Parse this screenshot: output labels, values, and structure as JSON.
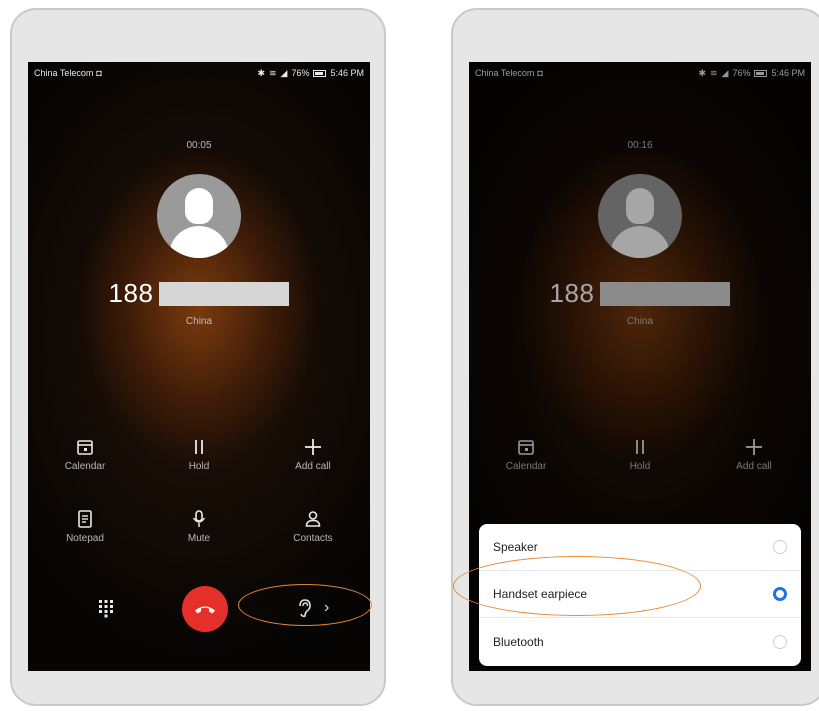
{
  "left": {
    "status": {
      "carrier": "China Telecom",
      "battery": "76%",
      "time": "5:46 PM"
    },
    "timer": "00:05",
    "number": "188",
    "location": "China",
    "actions_row1": [
      {
        "label": "Calendar",
        "icon": "calendar-icon"
      },
      {
        "label": "Hold",
        "icon": "pause-icon"
      },
      {
        "label": "Add call",
        "icon": "plus-icon"
      }
    ],
    "actions_row2": [
      {
        "label": "Notepad",
        "icon": "notepad-icon"
      },
      {
        "label": "Mute",
        "icon": "microphone-icon"
      },
      {
        "label": "Contacts",
        "icon": "person-icon"
      }
    ]
  },
  "right": {
    "status": {
      "carrier": "China Telecom",
      "battery": "76%",
      "time": "5:46 PM"
    },
    "timer": "00:16",
    "number": "188",
    "location": "China",
    "actions_row1": [
      {
        "label": "Calendar",
        "icon": "calendar-icon"
      },
      {
        "label": "Hold",
        "icon": "pause-icon"
      },
      {
        "label": "Add call",
        "icon": "plus-icon"
      }
    ],
    "audio_options": [
      {
        "label": "Speaker",
        "selected": false
      },
      {
        "label": "Handset earpiece",
        "selected": true
      },
      {
        "label": "Bluetooth",
        "selected": false
      }
    ]
  },
  "colors": {
    "end_call": "#e5302a",
    "radio_selected": "#1e72e8",
    "highlight": "#e68a3a"
  }
}
